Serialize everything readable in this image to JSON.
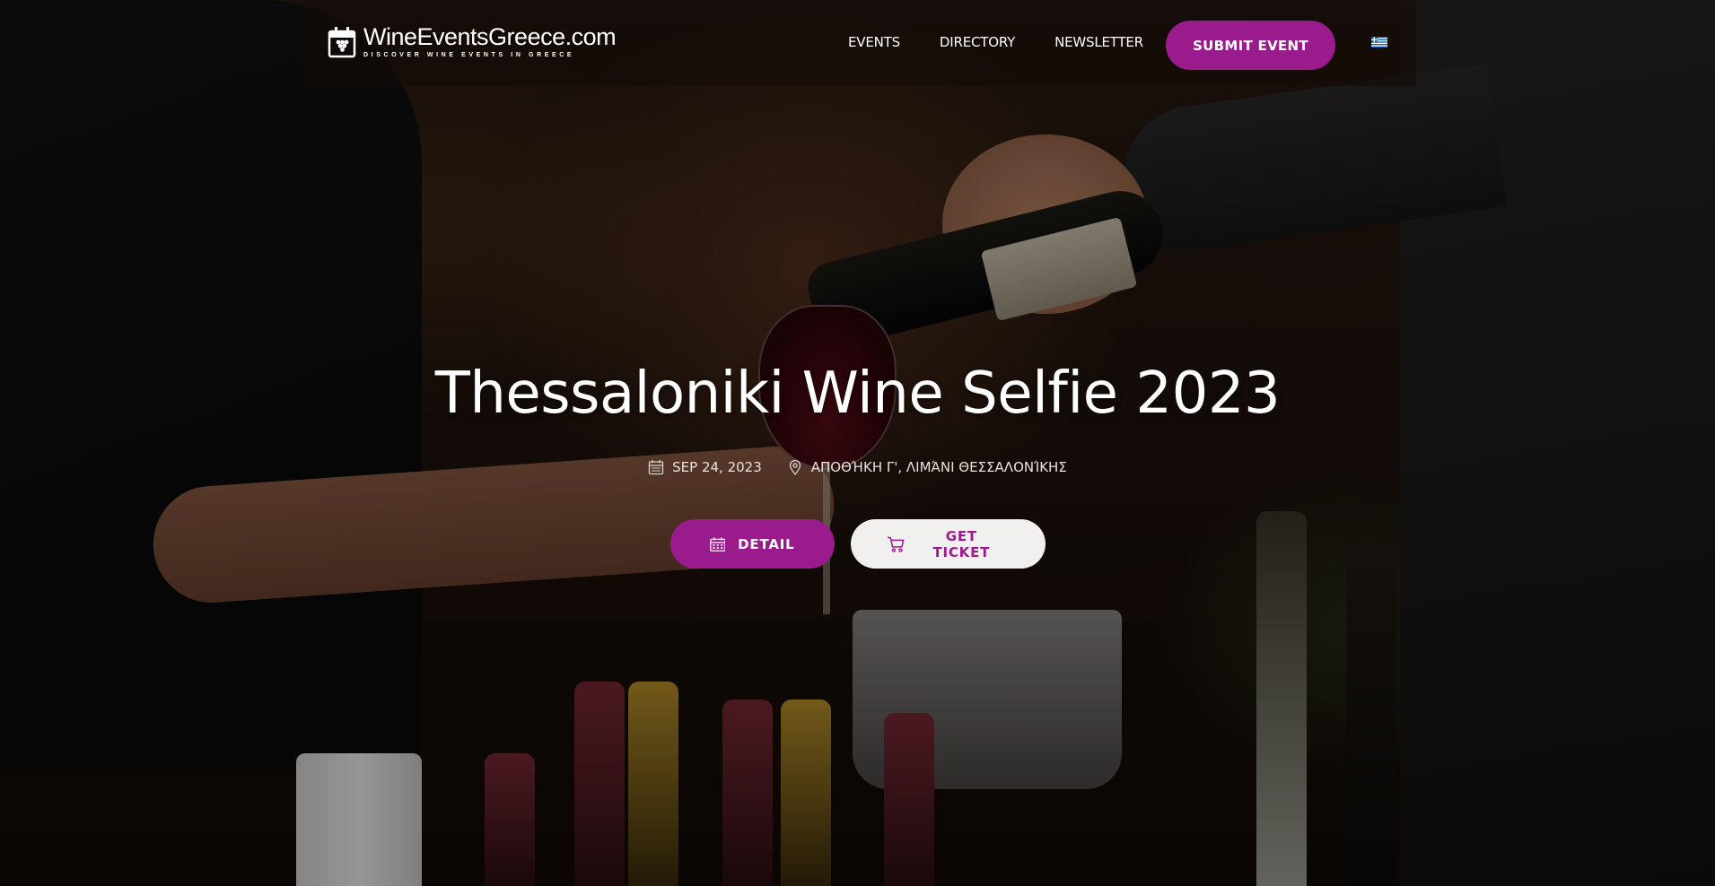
{
  "brand": {
    "name": "WineEventsGreece.com",
    "tagline": "DISCOVER WINE EVENTS IN GREECE",
    "accent_color": "#9a1b8b"
  },
  "nav": {
    "items": [
      {
        "label": "EVENTS"
      },
      {
        "label": "DIRECTORY"
      },
      {
        "label": "NEWSLETTER"
      }
    ],
    "submit_label": "SUBMIT EVENT",
    "language_icon": "greek-flag-icon"
  },
  "event": {
    "title": "Thessaloniki Wine Selfie 2023",
    "date": "SEP 24, 2023",
    "location": "ΑΠΟΘΉΚΗ Γ', ΛΙΜΆΝΙ ΘΕΣΣΑΛΟΝΊΚΗΣ",
    "date_icon": "calendar-icon",
    "location_icon": "map-pin-icon"
  },
  "actions": {
    "detail_label": "DETAIL",
    "detail_icon": "calendar-icon",
    "ticket_label": "GET TICKET",
    "ticket_icon": "cart-icon"
  }
}
